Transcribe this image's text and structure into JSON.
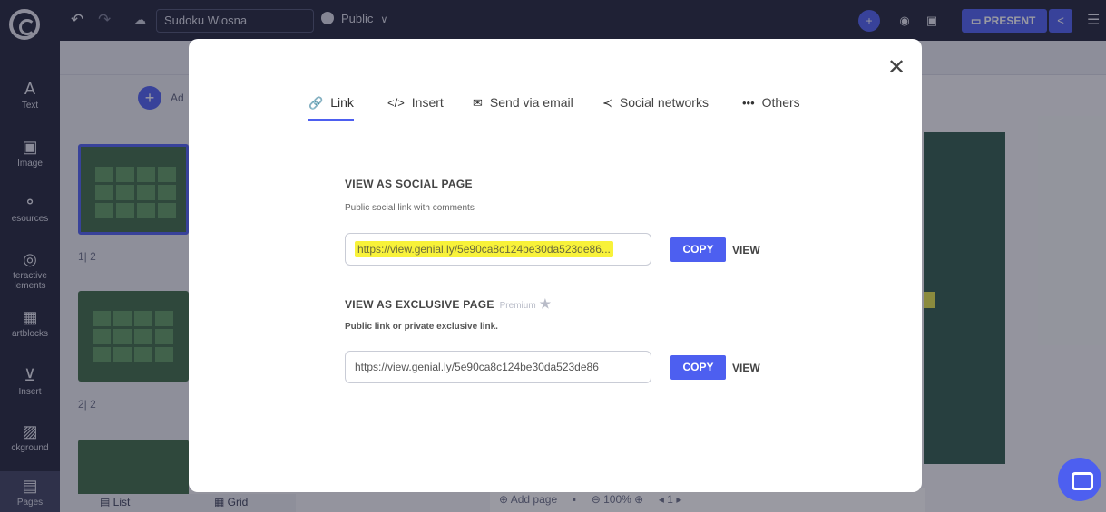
{
  "top_bar": {
    "document_title": "Sudoku Wiosna",
    "visibility": "Public",
    "present_label": "PRESENT"
  },
  "sidebar": {
    "items": [
      {
        "label": "Text",
        "icon": "text-icon"
      },
      {
        "label": "Image",
        "icon": "image-icon"
      },
      {
        "label": "esources",
        "icon": "resources-icon"
      },
      {
        "label": "teractive\nlements",
        "icon": "interactive-elements-icon"
      },
      {
        "label": "artblocks",
        "icon": "smartblocks-icon"
      },
      {
        "label": "Insert",
        "icon": "insert-icon"
      },
      {
        "label": "ckground",
        "icon": "background-icon"
      },
      {
        "label": "Pages",
        "icon": "pages-icon"
      }
    ]
  },
  "pages_panel": {
    "add_label": "Ad",
    "page1_number": "1| 2",
    "page2_number": "2| 2",
    "list_tab": "List",
    "grid_tab": "Grid"
  },
  "bottom_toolbar": {
    "add_page": "Add page",
    "zoom": "100%",
    "page": "1"
  },
  "share_modal": {
    "tabs": [
      {
        "label": "Link",
        "icon": "link-icon"
      },
      {
        "label": "Insert",
        "icon": "code-icon"
      },
      {
        "label": "Send via email",
        "icon": "email-icon"
      },
      {
        "label": "Social networks",
        "icon": "share-icon"
      },
      {
        "label": "Others",
        "icon": "more-icon"
      }
    ],
    "social": {
      "title": "VIEW AS SOCIAL PAGE",
      "subtitle": "Public social link with comments",
      "url": "https://view.genial.ly/5e90ca8c124be30da523de86...",
      "copy": "COPY",
      "view": "VIEW"
    },
    "exclusive": {
      "title": "VIEW AS EXCLUSIVE PAGE",
      "premium": "Premium",
      "subtitle": "Public link or private exclusive link.",
      "url": "https://view.genial.ly/5e90ca8c124be30da523de86",
      "copy": "COPY",
      "view": "VIEW"
    }
  },
  "colors": {
    "accent": "#4d5ff0",
    "highlight": "#f8f23a",
    "rail": "#20243a"
  }
}
